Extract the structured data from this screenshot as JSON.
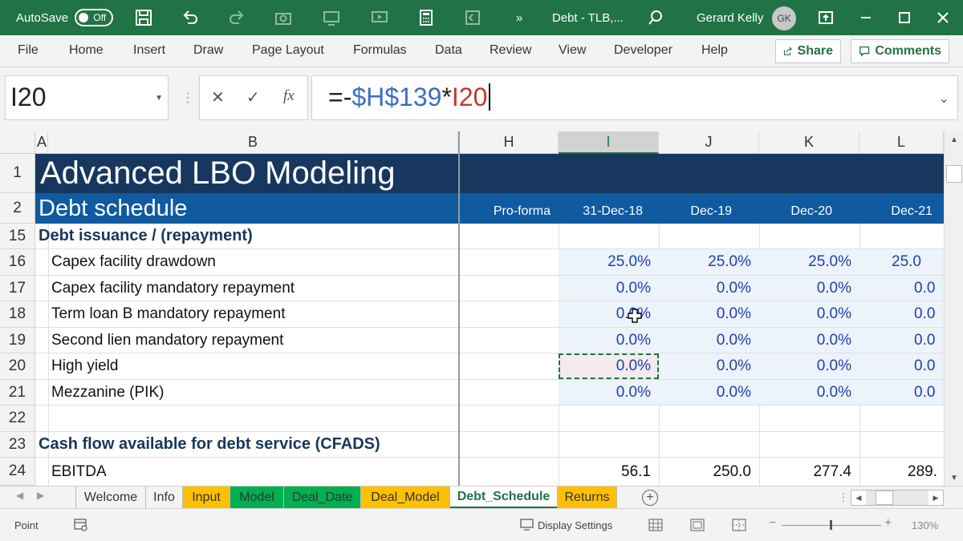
{
  "titlebar": {
    "autosave_label": "AutoSave",
    "autosave_state": "Off",
    "doc_title": "Debt - TLB,...",
    "user_name": "Gerard Kelly",
    "user_initials": "GK"
  },
  "ribbon": {
    "tabs": [
      "File",
      "Home",
      "Insert",
      "Draw",
      "Page Layout",
      "Formulas",
      "Data",
      "Review",
      "View",
      "Developer",
      "Help"
    ],
    "share_label": "Share",
    "comments_label": "Comments"
  },
  "formula_bar": {
    "name_box": "I20",
    "fx_label": "fx",
    "formula_part1": "=-",
    "formula_part2": "$H$139",
    "formula_part3": "*",
    "formula_part4": "I20"
  },
  "columns": [
    "A",
    "B",
    "H",
    "I",
    "J",
    "K",
    "L"
  ],
  "rows": {
    "r1": {
      "num": "1",
      "title": "Advanced LBO Modeling"
    },
    "r2": {
      "num": "2",
      "title": "Debt schedule",
      "h": "Pro-forma",
      "i": "31-Dec-18",
      "j": "Dec-19",
      "k": "Dec-20",
      "l": "Dec-21"
    },
    "r15": {
      "num": "15",
      "label": "Debt issuance / (repayment)"
    },
    "r16": {
      "num": "16",
      "label": "Capex facility drawdown",
      "i": "25.0%",
      "j": "25.0%",
      "k": "25.0%",
      "l": "25.0"
    },
    "r17": {
      "num": "17",
      "label": "Capex facility mandatory repayment",
      "i": "0.0%",
      "j": "0.0%",
      "k": "0.0%",
      "l": "0.0"
    },
    "r18": {
      "num": "18",
      "label": "Term loan B mandatory repayment",
      "i": "0.0%",
      "j": "0.0%",
      "k": "0.0%",
      "l": "0.0"
    },
    "r19": {
      "num": "19",
      "label": "Second lien mandatory repayment",
      "i": "0.0%",
      "j": "0.0%",
      "k": "0.0%",
      "l": "0.0"
    },
    "r20": {
      "num": "20",
      "label": "High yield",
      "i": "0.0%",
      "j": "0.0%",
      "k": "0.0%",
      "l": "0.0"
    },
    "r21": {
      "num": "21",
      "label": "Mezzanine (PIK)",
      "i": "0.0%",
      "j": "0.0%",
      "k": "0.0%",
      "l": "0.0"
    },
    "r22": {
      "num": "22"
    },
    "r23": {
      "num": "23",
      "label": "Cash flow available for debt service (CFADS)"
    },
    "r24": {
      "num": "24",
      "label": "EBITDA",
      "i": "56.1",
      "j": "250.0",
      "k": "277.4",
      "l": "289."
    }
  },
  "sheet_tabs": [
    "Welcome",
    "Info",
    "Input",
    "Model",
    "Deal_Date",
    "Deal_Model",
    "Debt_Schedule",
    "Returns"
  ],
  "tab_colors": {
    "Input": "#ffc000",
    "Model": "#00b050",
    "Deal_Date": "#00b050",
    "Deal_Model": "#ffc000",
    "Returns": "#ffc000",
    "band1": "#17375e",
    "band2": "#0f5aa0",
    "accent": "#217346"
  },
  "statusbar": {
    "mode": "Point",
    "display_settings": "Display Settings",
    "zoom": "130%"
  }
}
